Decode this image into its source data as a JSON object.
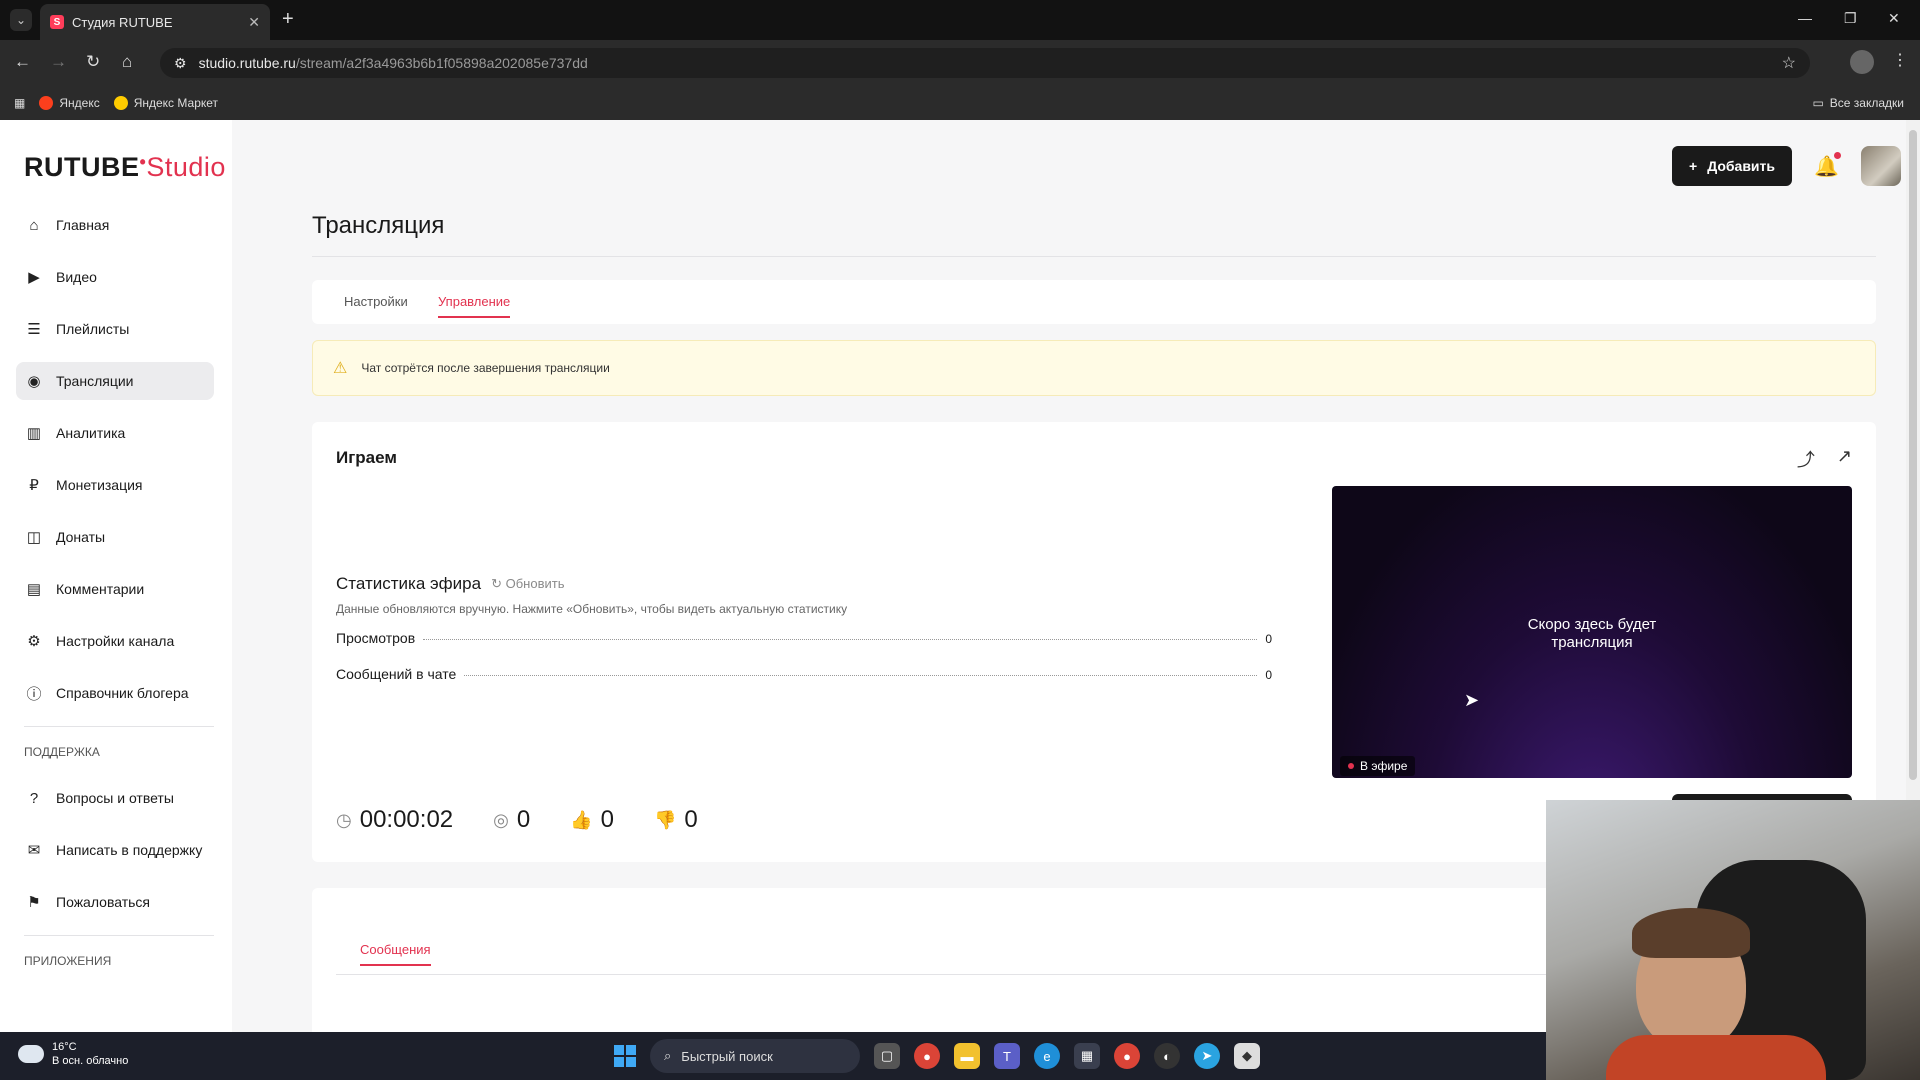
{
  "browser": {
    "tab_title": "Студия RUTUBE",
    "url_host": "studio.rutube.ru",
    "url_path": "/stream/a2f3a4963b6b1f05898a202085e737dd",
    "bookmarks": [
      {
        "label": "Яндекс",
        "icon": "yandex-icon",
        "color": "#fc3f1d"
      },
      {
        "label": "Яндекс Маркет",
        "icon": "market-icon",
        "color": "#ffcc00"
      }
    ],
    "all_bookmarks": "Все закладки"
  },
  "sidebar": {
    "logo_main": "RUTUBE",
    "logo_accent": "Studio",
    "items": [
      {
        "label": "Главная",
        "icon": "home-icon"
      },
      {
        "label": "Видео",
        "icon": "video-icon"
      },
      {
        "label": "Плейлисты",
        "icon": "playlist-icon"
      },
      {
        "label": "Трансляции",
        "icon": "broadcast-icon"
      },
      {
        "label": "Аналитика",
        "icon": "analytics-icon"
      },
      {
        "label": "Монетизация",
        "icon": "ruble-icon"
      },
      {
        "label": "Донаты",
        "icon": "donate-icon"
      },
      {
        "label": "Комментарии",
        "icon": "comments-icon"
      },
      {
        "label": "Настройки канала",
        "icon": "settings-icon"
      },
      {
        "label": "Справочник блогера",
        "icon": "info-icon"
      }
    ],
    "active_item": "Трансляции",
    "support_title": "ПОДДЕРЖКА",
    "support_items": [
      {
        "label": "Вопросы и ответы",
        "icon": "question-icon"
      },
      {
        "label": "Написать в поддержку",
        "icon": "mail-icon"
      },
      {
        "label": "Пожаловаться",
        "icon": "flag-icon"
      }
    ],
    "apps_title": "ПРИЛОЖЕНИЯ"
  },
  "header": {
    "add_label": "Добавить"
  },
  "main": {
    "title": "Трансляция",
    "tabs": [
      {
        "label": "Настройки"
      },
      {
        "label": "Управление"
      }
    ],
    "active_tab": "Управление",
    "warning": "Чат сотрётся после завершения трансляции",
    "stream_name": "Играем",
    "stats": {
      "title": "Статистика эфира",
      "refresh_label": "Обновить",
      "note": "Данные обновляются вручную. Нажмите «Обновить», чтобы видеть актуальную статистику",
      "rows": [
        {
          "label": "Просмотров",
          "value": "0"
        },
        {
          "label": "Сообщений в чате",
          "value": "0"
        }
      ]
    },
    "counters": {
      "duration": "00:00:02",
      "viewers": "0",
      "likes": "0",
      "dislikes": "0"
    },
    "preview": {
      "placeholder_line1": "Скоро здесь будет",
      "placeholder_line2": "трансляция",
      "live_label": "В эфире"
    },
    "chat_tab": "Сообщения"
  },
  "taskbar": {
    "temperature": "16°C",
    "weather": "В осн. облачно",
    "search_placeholder": "Быстрый поиск"
  },
  "colors": {
    "accent": "#e2324f",
    "warning_bg": "#fffbe5"
  }
}
